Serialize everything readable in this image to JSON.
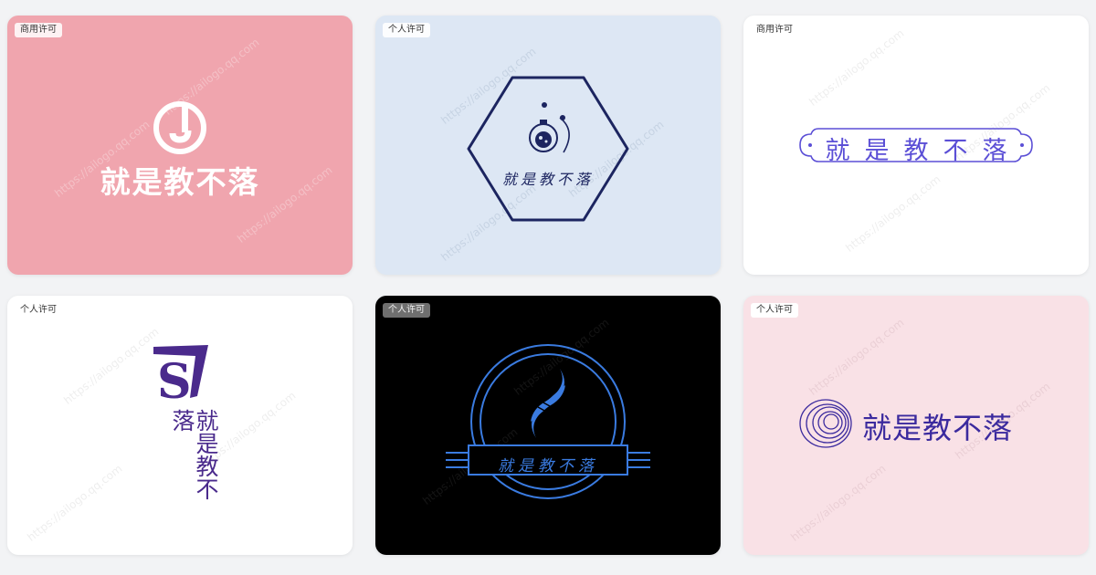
{
  "watermark": "https://ailogo.qq.com",
  "cards": [
    {
      "license": "商用许可",
      "brand": "就是教不落",
      "bg": "#f0a5ae",
      "mark_letter": "J",
      "icon": "letter-j-ring-icon"
    },
    {
      "license": "个人许可",
      "brand": "就是教不落",
      "bg": "#dde7f4",
      "accent": "#1c2560",
      "icon": "lab-flask-orbit-icon"
    },
    {
      "license": "商用许可",
      "brand": "就是教不落",
      "bg": "#ffffff",
      "accent": "#5b4fd6",
      "icon": "ornate-frame-icon"
    },
    {
      "license": "个人许可",
      "brand": "就是教不落",
      "bg": "#ffffff",
      "accent": "#4a2a8c",
      "mark_letter": "S",
      "icon": "letter-s-banner-icon"
    },
    {
      "license": "个人许可",
      "brand": "就是教不落",
      "bg": "#000000",
      "accent": "#3a7be0",
      "icon": "dna-emblem-icon"
    },
    {
      "license": "个人许可",
      "brand": "就是教不落",
      "bg": "#f9e1e6",
      "accent": "#3b2a9e",
      "icon": "spiral-rings-icon"
    }
  ]
}
